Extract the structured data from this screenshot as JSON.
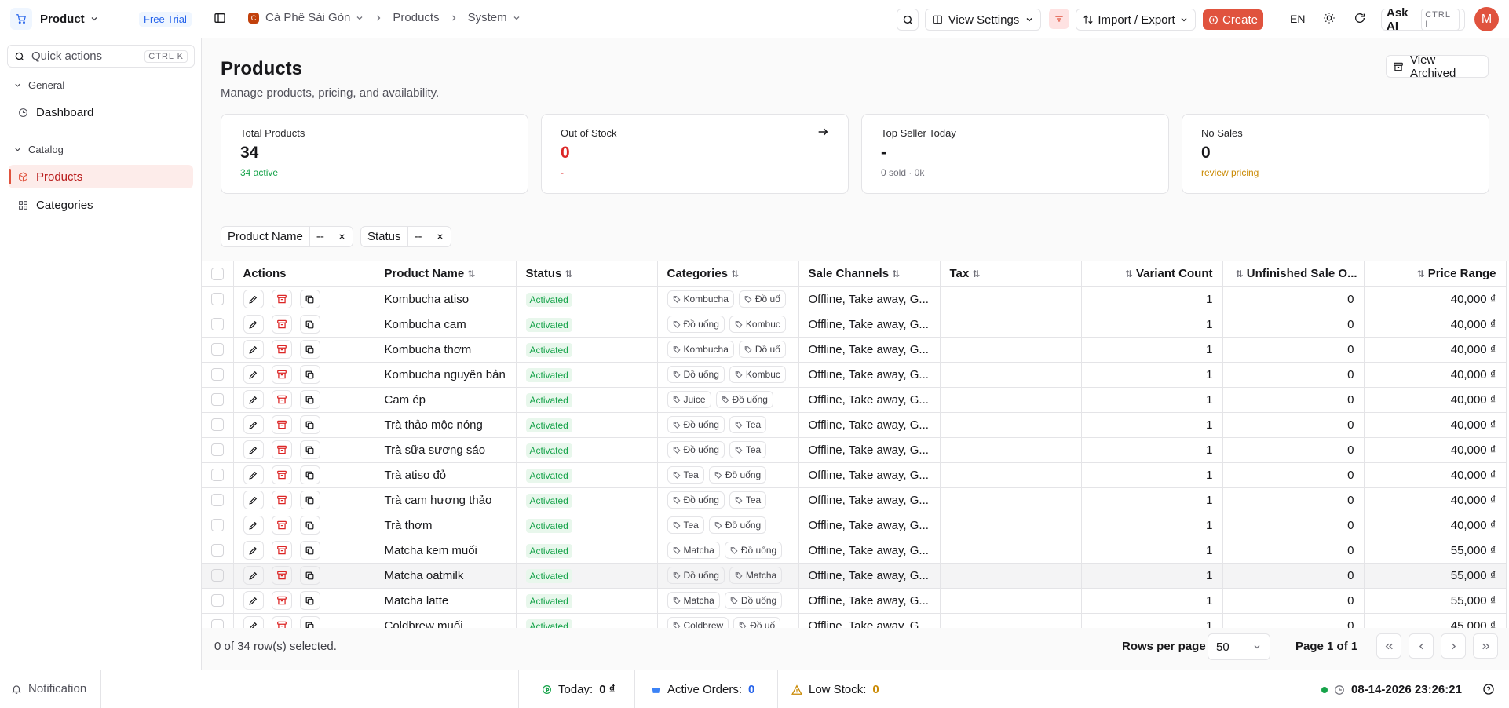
{
  "topbar": {
    "product_name": "Product",
    "trial_badge": "Free Trial",
    "breadcrumb": {
      "store": "Cà Phê Sài Gòn",
      "section": "Products",
      "sub": "System"
    },
    "view_settings": "View Settings",
    "import_export": "Import / Export",
    "create": "Create",
    "language": "EN",
    "ask_ai": "Ask AI",
    "ask_ai_shortcut": "CTRL I",
    "avatar_initial": "M"
  },
  "sidebar": {
    "quick_actions": "Quick actions",
    "quick_shortcut": "CTRL K",
    "groups": [
      {
        "label": "General",
        "items": [
          {
            "label": "Dashboard",
            "icon": "clock-icon"
          }
        ]
      },
      {
        "label": "Catalog",
        "items": [
          {
            "label": "Products",
            "icon": "box-icon",
            "active": true
          },
          {
            "label": "Categories",
            "icon": "grid-icon"
          }
        ]
      }
    ]
  },
  "page": {
    "title": "Products",
    "subtitle": "Manage products, pricing, and availability.",
    "view_archived": "View Archived"
  },
  "stats": [
    {
      "label": "Total Products",
      "value": "34",
      "sub": "34 active",
      "color": "#16a34a"
    },
    {
      "label": "Out of Stock",
      "value": "0",
      "sub": "-",
      "color": "#dc2626"
    },
    {
      "label": "Top Seller Today",
      "value": "-",
      "sub": "0 sold · 0k",
      "color": "#71717a"
    },
    {
      "label": "No Sales",
      "value": "0",
      "sub": "review pricing",
      "color": "#ca8a04"
    }
  ],
  "filters": [
    {
      "label": "Product Name",
      "value": "--"
    },
    {
      "label": "Status",
      "value": "--"
    }
  ],
  "table": {
    "columns": [
      "Actions",
      "Product Name",
      "Status",
      "Categories",
      "Sale Channels",
      "Tax",
      "Variant Count",
      "Unfinished Sale O...",
      "Price Range"
    ],
    "rows": [
      {
        "name": "Kombucha atiso",
        "status": "Activated",
        "cats": [
          "Kombucha",
          "Đồ uố"
        ],
        "channels": "Offline, Take away, G...",
        "tax": "",
        "variants": "1",
        "unfinished": "0",
        "price": "40,000 ₫"
      },
      {
        "name": "Kombucha cam",
        "status": "Activated",
        "cats": [
          "Đồ uống",
          "Kombuc"
        ],
        "channels": "Offline, Take away, G...",
        "tax": "",
        "variants": "1",
        "unfinished": "0",
        "price": "40,000 ₫"
      },
      {
        "name": "Kombucha thơm",
        "status": "Activated",
        "cats": [
          "Kombucha",
          "Đồ uố"
        ],
        "channels": "Offline, Take away, G...",
        "tax": "",
        "variants": "1",
        "unfinished": "0",
        "price": "40,000 ₫"
      },
      {
        "name": "Kombucha nguyên bản",
        "status": "Activated",
        "cats": [
          "Đồ uống",
          "Kombuc"
        ],
        "channels": "Offline, Take away, G...",
        "tax": "",
        "variants": "1",
        "unfinished": "0",
        "price": "40,000 ₫"
      },
      {
        "name": "Cam ép",
        "status": "Activated",
        "cats": [
          "Juice",
          "Đồ uống"
        ],
        "channels": "Offline, Take away, G...",
        "tax": "",
        "variants": "1",
        "unfinished": "0",
        "price": "40,000 ₫"
      },
      {
        "name": "Trà thảo mộc nóng",
        "status": "Activated",
        "cats": [
          "Đồ uống",
          "Tea"
        ],
        "channels": "Offline, Take away, G...",
        "tax": "",
        "variants": "1",
        "unfinished": "0",
        "price": "40,000 ₫"
      },
      {
        "name": "Trà sữa sương sáo",
        "status": "Activated",
        "cats": [
          "Đồ uống",
          "Tea"
        ],
        "channels": "Offline, Take away, G...",
        "tax": "",
        "variants": "1",
        "unfinished": "0",
        "price": "40,000 ₫"
      },
      {
        "name": "Trà atiso đỏ",
        "status": "Activated",
        "cats": [
          "Tea",
          "Đồ uống"
        ],
        "channels": "Offline, Take away, G...",
        "tax": "",
        "variants": "1",
        "unfinished": "0",
        "price": "40,000 ₫"
      },
      {
        "name": "Trà cam hương thảo",
        "status": "Activated",
        "cats": [
          "Đồ uống",
          "Tea"
        ],
        "channels": "Offline, Take away, G...",
        "tax": "",
        "variants": "1",
        "unfinished": "0",
        "price": "40,000 ₫"
      },
      {
        "name": "Trà thơm",
        "status": "Activated",
        "cats": [
          "Tea",
          "Đồ uống"
        ],
        "channels": "Offline, Take away, G...",
        "tax": "",
        "variants": "1",
        "unfinished": "0",
        "price": "40,000 ₫"
      },
      {
        "name": "Matcha kem muối",
        "status": "Activated",
        "cats": [
          "Matcha",
          "Đồ uống"
        ],
        "channels": "Offline, Take away, G...",
        "tax": "",
        "variants": "1",
        "unfinished": "0",
        "price": "55,000 ₫"
      },
      {
        "name": "Matcha oatmilk",
        "status": "Activated",
        "cats": [
          "Đồ uống",
          "Matcha"
        ],
        "channels": "Offline, Take away, G...",
        "tax": "",
        "variants": "1",
        "unfinished": "0",
        "price": "55,000 ₫",
        "highlight": true
      },
      {
        "name": "Matcha latte",
        "status": "Activated",
        "cats": [
          "Matcha",
          "Đồ uống"
        ],
        "channels": "Offline, Take away, G...",
        "tax": "",
        "variants": "1",
        "unfinished": "0",
        "price": "55,000 ₫"
      },
      {
        "name": "Coldbrew muối",
        "status": "Activated",
        "cats": [
          "Coldbrew",
          "Đồ uố"
        ],
        "channels": "Offline, Take away, G...",
        "tax": "",
        "variants": "1",
        "unfinished": "0",
        "price": "45,000 ₫"
      }
    ]
  },
  "footer": {
    "selected": "0 of 34 row(s) selected.",
    "rows_per_page_label": "Rows per page",
    "rows_per_page": "50",
    "page": "Page 1 of 1"
  },
  "statusbar": {
    "notification": "Notification",
    "today_label": "Today:",
    "today_value": "0 ₫",
    "orders_label": "Active Orders:",
    "orders_value": "0",
    "low_stock_label": "Low Stock:",
    "low_stock_value": "0",
    "datetime": "08-14-2026 23:26:21"
  }
}
